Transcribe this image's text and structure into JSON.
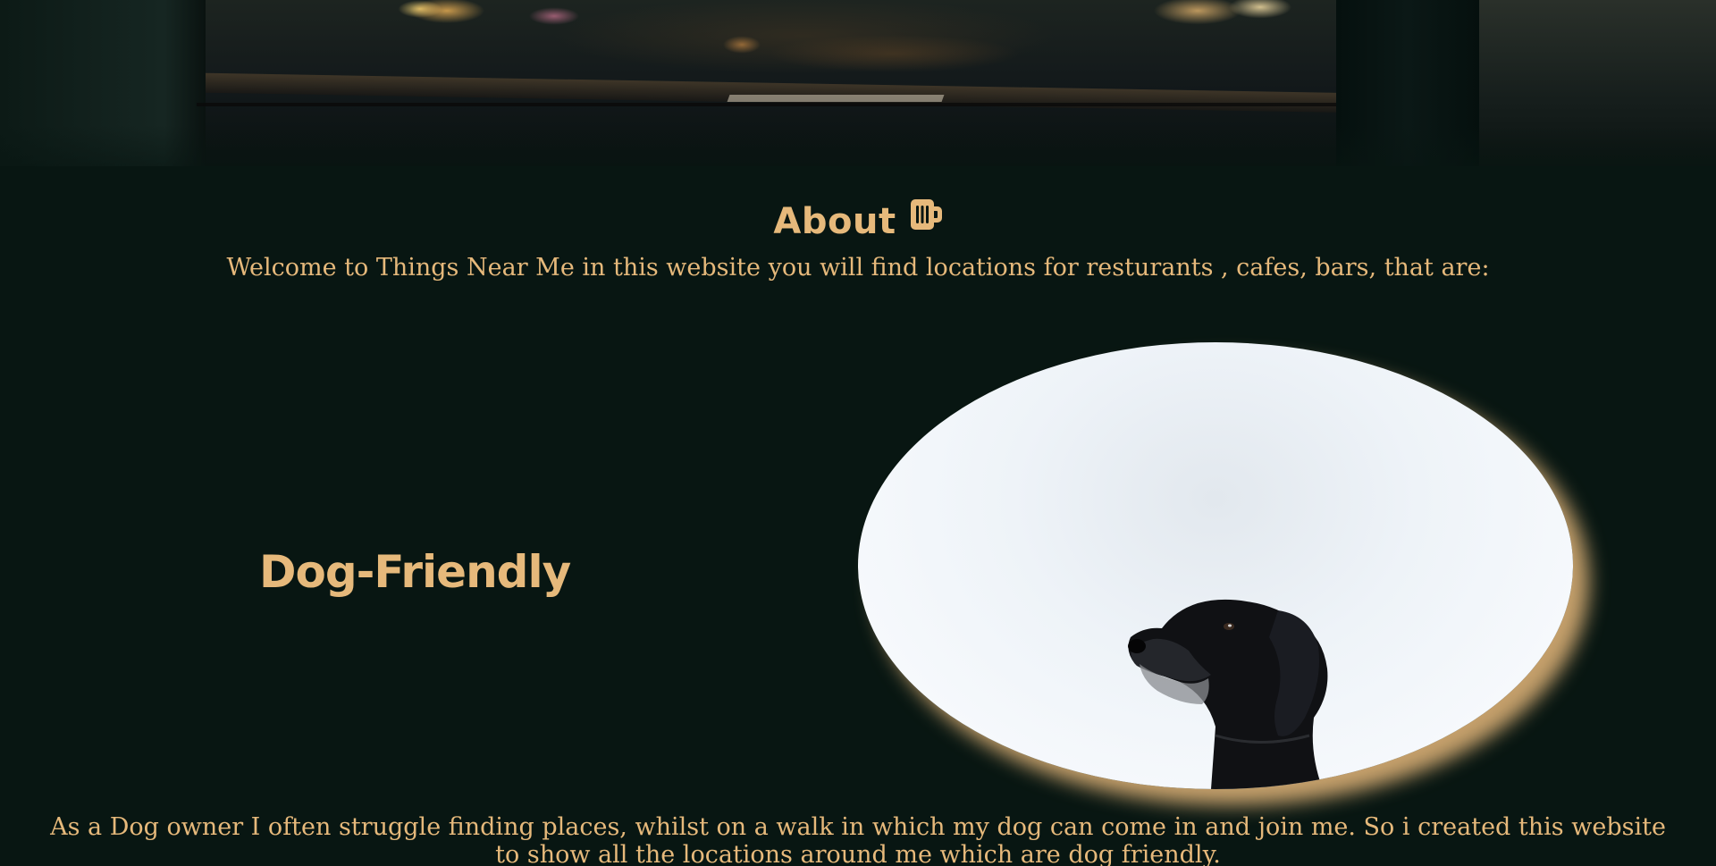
{
  "hero": {
    "image_description": "blurred restaurant bar scene at night"
  },
  "about": {
    "heading": "About",
    "heading_icon": "beer-mug-icon",
    "intro": "Welcome to Things Near Me in this website you will find locations for resturants , cafes, bars, that are:"
  },
  "feature": {
    "title": "Dog-Friendly",
    "image_subject": "black-dog-photo"
  },
  "story": {
    "text": "As a Dog owner I often struggle finding places, whilst on a walk in which my dog can come in and join me. So i created this website to show all the locations around me which are dog friendly."
  },
  "colors": {
    "background": "#081612",
    "accent": "#e6b97b"
  }
}
